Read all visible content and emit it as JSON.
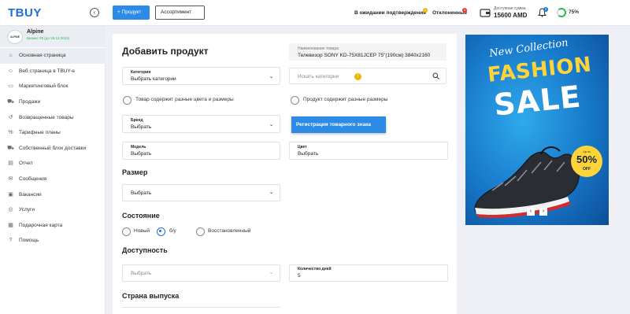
{
  "header": {
    "logo": "TBUY",
    "collapse_icon": "chevron-left-icon",
    "add_product": "+ Продукт",
    "assortment": "Ассортимент",
    "pending": "В ожидании подтверждения",
    "pending_badge": "1",
    "rejected": "Отклоненные",
    "rejected_badge": "1",
    "balance_label": "Доступная сумма",
    "balance_value": "15600 AMD",
    "notif_badge": "2",
    "progress_value": "75%",
    "progress_fraction": 0.75
  },
  "sidebar": {
    "profile": {
      "avatar_text": "ALPINE",
      "name": "Alpine",
      "subtitle": "Бизнес #5 (до 18.12.2021)"
    },
    "items": [
      {
        "label": "Основная страница",
        "icon": "home-icon",
        "glyph": "⌂"
      },
      {
        "label": "Веб страница в TBUY-е",
        "icon": "user-icon",
        "glyph": "☺"
      },
      {
        "label": "Маркетинговый блок",
        "icon": "monitor-icon",
        "glyph": "▭"
      },
      {
        "label": "Продажи",
        "icon": "cart-icon",
        "glyph": "⛟"
      },
      {
        "label": "Возвращенные товары",
        "icon": "return-icon",
        "glyph": "↺"
      },
      {
        "label": "Тарифные планы",
        "icon": "percent-icon",
        "glyph": "%"
      },
      {
        "label": "Собственный блок доставки",
        "icon": "truck-icon",
        "glyph": "⛟"
      },
      {
        "label": "Отчет",
        "icon": "report-icon",
        "glyph": "▤"
      },
      {
        "label": "Сообщения",
        "icon": "mail-icon",
        "glyph": "✉"
      },
      {
        "label": "Вакансии",
        "icon": "briefcase-icon",
        "glyph": "▣"
      },
      {
        "label": "Услуги",
        "icon": "globe-icon",
        "glyph": "◎"
      },
      {
        "label": "Подарочная карта",
        "icon": "gift-card-icon",
        "glyph": "▦"
      },
      {
        "label": "Помощь",
        "icon": "help-icon",
        "glyph": "?"
      }
    ]
  },
  "form": {
    "title": "Добавить продукт",
    "product_name_label": "Наименование товара",
    "product_name_value": "Телевизор SONY KD-75X81JCEP 75\"(190см) 3840x2160",
    "category_label": "Категория",
    "category_value": "Выбрать категории",
    "search_placeholder": "Искать категории",
    "search_badge": "!",
    "option_colors_sizes": "Товар содержит разные цвета и размеры",
    "option_sizes": "Продукт содержит разные размеры",
    "brand_label": "Бренд",
    "brand_value": "Выбрать",
    "trademark_button": "Регистрация товарного знака",
    "model_label": "Модель",
    "model_value": "Выбрать",
    "color_label": "Цвет",
    "color_value": "Выбрать",
    "size_heading": "Размер",
    "size_value": "Выбрать",
    "condition_heading": "Состояние",
    "condition_options": [
      "Новый",
      "б/у",
      "Восстановленный"
    ],
    "condition_selected": "б/у",
    "availability_heading": "Доступность",
    "availability_value": "Выбрать",
    "days_label": "Количество дней",
    "days_value": "5",
    "country_heading": "Страна выпуска"
  },
  "banner": {
    "line1": "New Collection",
    "line2": "FASHION",
    "line3": "SALE",
    "tag_top": "Up to",
    "tag_percent": "50%",
    "tag_bottom": "OFF",
    "prev": "‹",
    "next": "›"
  },
  "colors": {
    "accent": "#2b8be5",
    "logo": "#1d6fd8",
    "success": "#2db84a",
    "banner_yellow": "#ffd43b"
  }
}
